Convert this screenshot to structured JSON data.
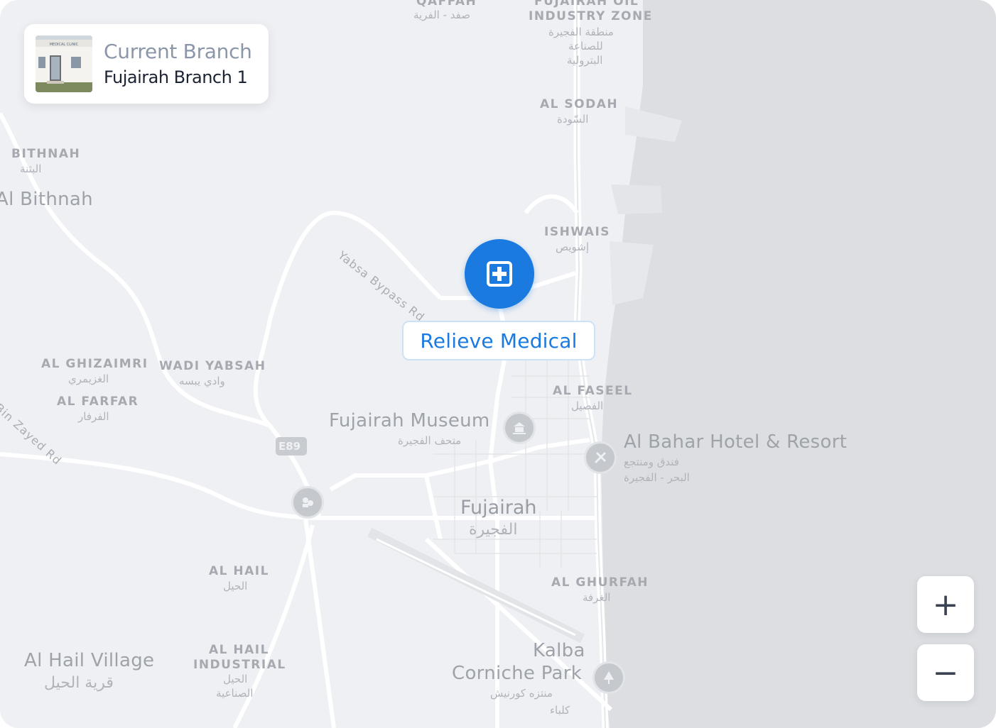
{
  "branch": {
    "title": "Current Branch",
    "name": "Fujairah Branch 1",
    "thumbnail_sign": "MEDICAL CLINIC"
  },
  "marker": {
    "label": "Relieve Medical",
    "icon": "medical-plus-icon",
    "color": "#1a7ae0"
  },
  "zoom": {
    "in_label": "+",
    "out_label": "−"
  },
  "map": {
    "colors": {
      "land": "#eff0f3",
      "sea": "#dcdee1",
      "road": "#ffffff",
      "label": "#a3a7ad"
    },
    "labels": {
      "qidfa": "صفد - الفرية",
      "qidfa_top": "QAFFAH",
      "fujairah_oil_top": "FUJAIRAH OIL",
      "industry_zone": "INDUSTRY ZONE",
      "industry_zone_ar1": "منطقة الفجيرة",
      "industry_zone_ar2": "للصناعة",
      "industry_zone_ar3": "البترولية",
      "al_sodah": "AL SODAH",
      "al_sodah_ar": "السّودة",
      "bithnah": "BITHNAH",
      "bithnah_ar": "البثنة",
      "al_bithnah": "Al Bithnah",
      "ishwais": "ISHWAIS",
      "ishwais_ar": "إشويص",
      "yabsa_road": "Yabsa Bypass Rd",
      "al_ghizaimri": "AL GHIZAIMRI",
      "al_ghizaimri_ar": "الغزيمري",
      "wadi_yabsah": "WADI YABSAH",
      "wadi_yabsah_ar": "وادي يبسه",
      "al_farfar": "AL FARFAR",
      "al_farfar_ar": "الفرفار",
      "zayed_road": "Bin Zayed Rd",
      "al_faseel": "AL FASEEL",
      "al_faseel_ar": "الفصيل",
      "museum": "Fujairah Museum",
      "museum_ar": "متحف الفجيرة",
      "hotel": "Al Bahar Hotel & Resort",
      "hotel_ar1": "فندق ومنتجع",
      "hotel_ar2": "البحر - الفجيرة",
      "e89": "E89",
      "fujairah": "Fujairah",
      "fujairah_ar": "الفجيرة",
      "al_hail": "AL HAIL",
      "al_hail_ar": "الحيل",
      "al_ghurfah": "AL GHURFAH",
      "al_ghurfah_ar": "الغرفة",
      "al_hail_village": "Al Hail Village",
      "al_hail_village_ar": "قرية الحيل",
      "al_hail_industrial1": "AL HAIL",
      "al_hail_industrial2": "INDUSTRIAL",
      "al_hail_industrial_ar1": "الحيل",
      "al_hail_industrial_ar2": "الصناعية",
      "kalba1": "Kalba",
      "kalba2": "Corniche Park",
      "kalba_ar1": "منتزه كورنيش",
      "kalba_ar2": "كلباء"
    }
  }
}
